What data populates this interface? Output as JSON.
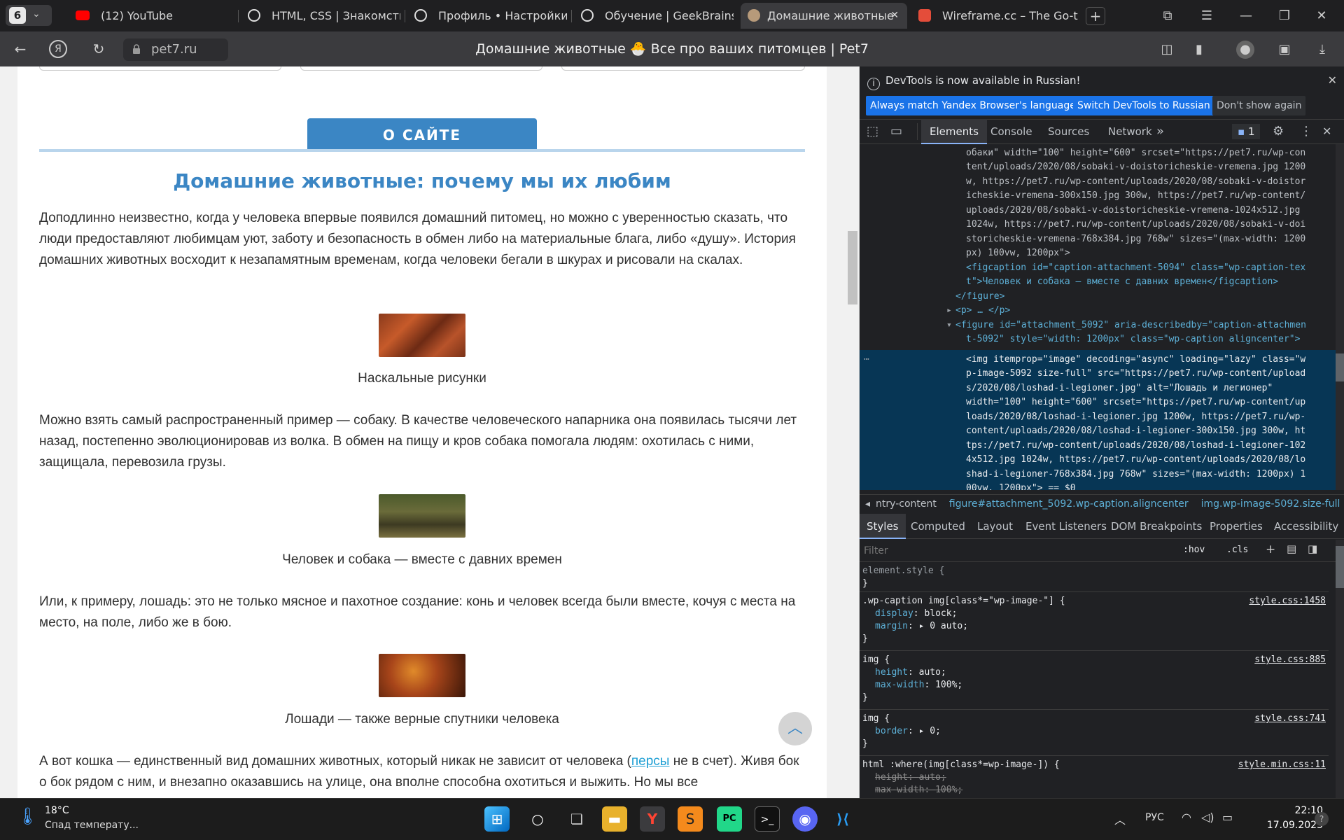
{
  "browser": {
    "tab_count": "6",
    "tabs": [
      {
        "label": "(12) YouTube"
      },
      {
        "label": "HTML, CSS | Знакомство"
      },
      {
        "label": "Профиль • Настройки п"
      },
      {
        "label": "Обучение | GeekBrains -"
      },
      {
        "label": "Домашние животные"
      },
      {
        "label": "Wireframe.cc – The Go-to"
      }
    ],
    "url": "pet7.ru",
    "page_title": "Домашние животные 🐣 Все про ваших питомцев | Pet7"
  },
  "page": {
    "about_button": "О САЙТЕ",
    "heading": "Домашние животные: почему мы их любим",
    "p1": "Доподлинно  неизвестно, когда у человека впервые появился домашний питомец, но можно с уверенностью сказать, что люди предоставляют любимцам уют, заботу и безопасность в обмен либо на материальные блага, либо «душу». История домашних животных восходит к незапамятным временам, когда человеки бегали в шкурах и рисовали на скалах.",
    "cap1": "Наскальные рисунки",
    "p2": "Можно взять самый распространенный пример — собаку. В качестве человеческого напарника она появилась тысячи лет назад, постепенно эволюционировав из волка. В обмен на пищу и кров собака помогала людям: охотилась с ними, защищала, перевозила грузы.",
    "cap2": "Человек и собака — вместе с давних времен",
    "p3": "Или, к примеру, лошадь: это не только мясное и пахотное создание: конь и человек всегда были вместе, кочуя с места на место, на поле, либо же в бою.",
    "cap3": "Лошади — также верные спутники человека",
    "p4_a": "А вот кошка — единственный вид домашних животных, который никак не зависит от человека (",
    "p4_link": "персы",
    "p4_b": " не в счет). Живя бок о бок рядом с ним, и внезапно оказавшись на улице, она вполне способна охотиться и выжить. Но мы все"
  },
  "devtools": {
    "info": "DevTools is now available in Russian!",
    "btn_match": "Always match Yandex Browser's language",
    "btn_switch": "Switch DevTools to Russian",
    "btn_dont": "Don't show again",
    "tabs": [
      "Elements",
      "Console",
      "Sources",
      "Network"
    ],
    "issues": "1",
    "breadcrumbs": [
      "ntry-content",
      "figure#attachment_5092.wp-caption.aligncenter",
      "img.wp-image-5092.size-full"
    ],
    "style_tabs": [
      "Styles",
      "Computed",
      "Layout",
      "Event Listeners",
      "DOM Breakpoints",
      "Properties",
      "Accessibility"
    ],
    "filter_placeholder": "Filter",
    "hov": ":hov",
    "cls": ".cls",
    "dom_lines": [
      "обаки\" width=\"100\" height=\"600\" srcset=\"https://pet7.ru/wp-con",
      "tent/uploads/2020/08/sobaki-v-doistoricheskie-vremena.jpg 1200",
      "w, https://pet7.ru/wp-content/uploads/2020/08/sobaki-v-doistor",
      "icheskie-vremena-300x150.jpg 300w, https://pet7.ru/wp-content/",
      "uploads/2020/08/sobaki-v-doistoricheskie-vremena-1024x512.jpg",
      "1024w, https://pet7.ru/wp-content/uploads/2020/08/sobaki-v-doi",
      "storicheskie-vremena-768x384.jpg 768w\" sizes=\"(max-width: 1200",
      "px) 100vw, 1200px\">",
      "<figcaption id=\"caption-attachment-5094\" class=\"wp-caption-tex",
      "t\">Человек и собака – вместе с давних времен</figcaption>",
      "</figure>",
      "<p> … </p>",
      "<figure id=\"attachment_5092\" aria-describedby=\"caption-attachmen",
      "t-5092\" style=\"width: 1200px\" class=\"wp-caption aligncenter\">",
      "<img itemprop=\"image\" decoding=\"async\" loading=\"lazy\" class=\"w",
      "p-image-5092 size-full\" src=\"https://pet7.ru/wp-content/upload",
      "s/2020/08/loshad-i-legioner.jpg\" alt=\"Лошадь и легионер\"",
      "width=\"100\" height=\"600\" srcset=\"https://pet7.ru/wp-content/up",
      "loads/2020/08/loshad-i-legioner.jpg 1200w, https://pet7.ru/wp-",
      "content/uploads/2020/08/loshad-i-legioner-300x150.jpg 300w, ht",
      "tps://pet7.ru/wp-content/uploads/2020/08/loshad-i-legioner-102",
      "4x512.jpg 1024w, https://pet7.ru/wp-content/uploads/2020/08/lo",
      "shad-i-legioner-768x384.jpg 768w\" sizes=\"(max-width: 1200px) 1",
      "00vw, 1200px\"> == $0"
    ],
    "rules": [
      {
        "selector": "element.style {",
        "lines": [],
        "close": "}",
        "source": ""
      },
      {
        "selector": ".wp-caption img[class*=\"wp-image-\"] {",
        "lines": [
          [
            "display",
            "block;"
          ],
          [
            "margin",
            "▸ 0 auto;"
          ]
        ],
        "close": "}",
        "source": "style.css:1458"
      },
      {
        "selector": "img {",
        "lines": [
          [
            "height",
            "auto;"
          ],
          [
            "max-width",
            "100%;"
          ]
        ],
        "close": "}",
        "source": "style.css:885"
      },
      {
        "selector": "img {",
        "lines": [
          [
            "border",
            "▸ 0;"
          ]
        ],
        "close": "}",
        "source": "style.css:741"
      },
      {
        "selector": "html :where(img[class*=wp-image-]) {",
        "lines": [
          [
            "height",
            "auto;"
          ],
          [
            "max-width",
            "100%;"
          ]
        ],
        "close": "",
        "source": "style.min.css:11"
      }
    ]
  },
  "taskbar": {
    "temp": "18°C",
    "weather": "Спад температу...",
    "lang": "РУС",
    "time": "22:10",
    "date": "17.09.2023"
  }
}
